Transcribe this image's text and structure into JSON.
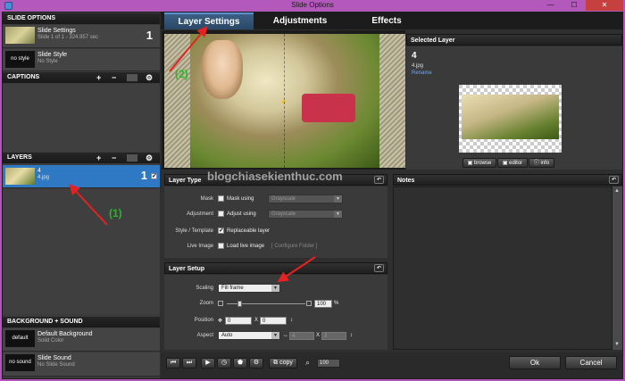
{
  "window": {
    "title": "Slide Options",
    "min": "—",
    "max": "☐",
    "close": "✕"
  },
  "left": {
    "slide_options_header": "SLIDE OPTIONS",
    "slide_settings": {
      "title": "Slide Settings",
      "subtitle": "Slide 1 of 1 - 324.957 sec",
      "count": "1"
    },
    "slide_style": {
      "thumb": "no style",
      "title": "Slide Style",
      "subtitle": "No Style"
    },
    "captions_header": "CAPTIONS",
    "layers_header": "LAYERS",
    "layer": {
      "title": "4",
      "subtitle": "4.jpg",
      "count": "1"
    },
    "bg_header": "BACKGROUND + SOUND",
    "bg": {
      "thumb": "default",
      "title": "Default Background",
      "subtitle": "Solid Color"
    },
    "sound": {
      "thumb": "no sound",
      "title": "Slide Sound",
      "subtitle": "No Slide Sound"
    },
    "plus": "+",
    "minus": "−",
    "gear": "⚙"
  },
  "tabs": [
    {
      "label": "Layer Settings"
    },
    {
      "label": "Adjustments"
    },
    {
      "label": "Effects"
    }
  ],
  "selected_layer": {
    "header": "Selected Layer",
    "number": "4",
    "file": "4.jpg",
    "rename": "Rename",
    "browse": "browse",
    "editor": "editor",
    "info": "info"
  },
  "layer_type": {
    "header": "Layer Type",
    "mask_label": "Mask",
    "mask_check": "Mask using",
    "mask_select": "Grayscale",
    "adjust_label": "Adjustment",
    "adjust_check": "Adjust using",
    "adjust_select": "Grayscale",
    "style_label": "Style / Template",
    "style_check": "Replaceable layer",
    "live_label": "Live Image",
    "live_check": "Load live image",
    "configure": "[ Configure Folder ]"
  },
  "notes": {
    "header": "Notes"
  },
  "layer_setup": {
    "header": "Layer Setup",
    "scaling_label": "Scaling",
    "scaling_value": "Fill frame",
    "zoom_label": "Zoom",
    "zoom_value": "100",
    "zoom_unit": "%",
    "position_label": "Position",
    "pos_x_prefix": "X",
    "pos_x": "0",
    "pos_y_prefix": "X",
    "pos_y": "0",
    "aspect_label": "Aspect",
    "aspect_value": "Auto",
    "aspect_w": "4",
    "aspect_x": "X",
    "aspect_h": "3"
  },
  "bottom": {
    "copy": "copy",
    "zoom": "100",
    "ok": "Ok",
    "cancel": "Cancel"
  },
  "annotations": {
    "one": "(1)",
    "two": "(2)"
  },
  "watermark": "blogchiasekienthuc.com"
}
